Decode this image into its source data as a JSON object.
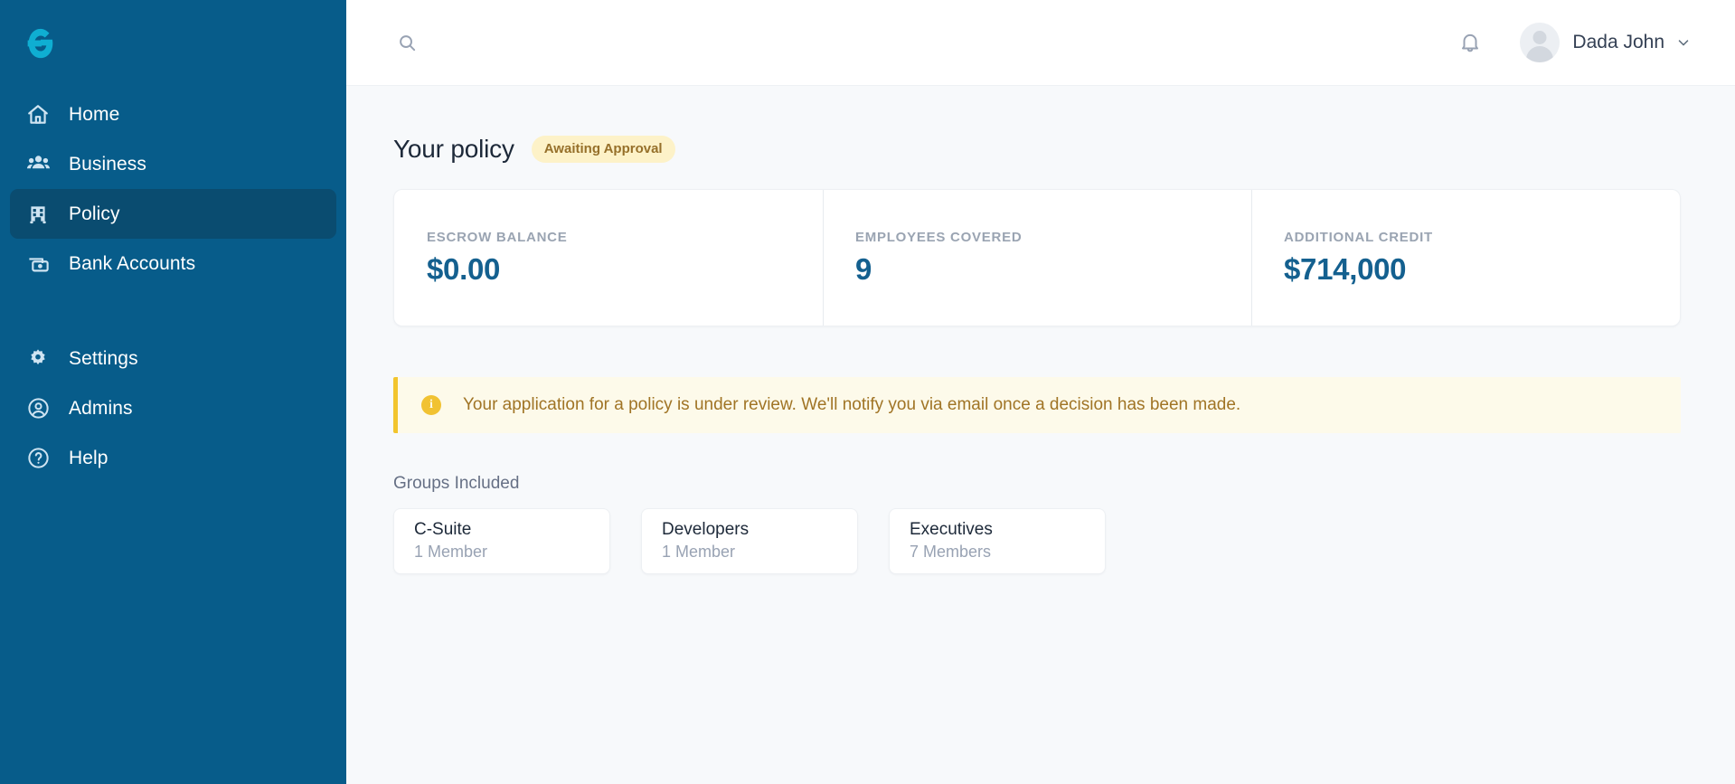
{
  "brand": {
    "logo_icon": "g-logo-icon",
    "sidebar_bg": "#075c8a",
    "accent": "#14608f"
  },
  "sidebar": {
    "primary_items": [
      {
        "label": "Home",
        "icon": "home-icon",
        "active": false
      },
      {
        "label": "Business",
        "icon": "people-group-icon",
        "active": false
      },
      {
        "label": "Policy",
        "icon": "building-icon",
        "active": true
      },
      {
        "label": "Bank Accounts",
        "icon": "bank-card-icon",
        "active": false
      }
    ],
    "secondary_items": [
      {
        "label": "Settings",
        "icon": "gear-icon",
        "active": false
      },
      {
        "label": "Admins",
        "icon": "user-circle-icon",
        "active": false
      },
      {
        "label": "Help",
        "icon": "question-circle-icon",
        "active": false
      }
    ]
  },
  "topbar": {
    "search_icon": "search-icon",
    "notifications_icon": "bell-icon",
    "user_name": "Dada John",
    "chevron_icon": "chevron-down-icon",
    "avatar_icon": "avatar-placeholder-icon"
  },
  "page": {
    "title": "Your policy",
    "status_badge": "Awaiting Approval",
    "status_badge_bg": "#fdf2c8",
    "status_badge_color": "#96702a"
  },
  "stats": [
    {
      "label": "ESCROW BALANCE",
      "value": "$0.00"
    },
    {
      "label": "EMPLOYEES COVERED",
      "value": "9"
    },
    {
      "label": "ADDITIONAL CREDIT",
      "value": "$714,000"
    }
  ],
  "alert": {
    "icon": "info-circle-icon",
    "text": "Your application for a policy is under review. We'll notify you via email once a decision has been made.",
    "bg": "#fdfaea",
    "accent": "#f2c52d",
    "text_color": "#a07425"
  },
  "groups": {
    "title": "Groups Included",
    "items": [
      {
        "name": "C-Suite",
        "count": "1 Member"
      },
      {
        "name": "Developers",
        "count": "1 Member"
      },
      {
        "name": "Executives",
        "count": "7 Members"
      }
    ]
  }
}
